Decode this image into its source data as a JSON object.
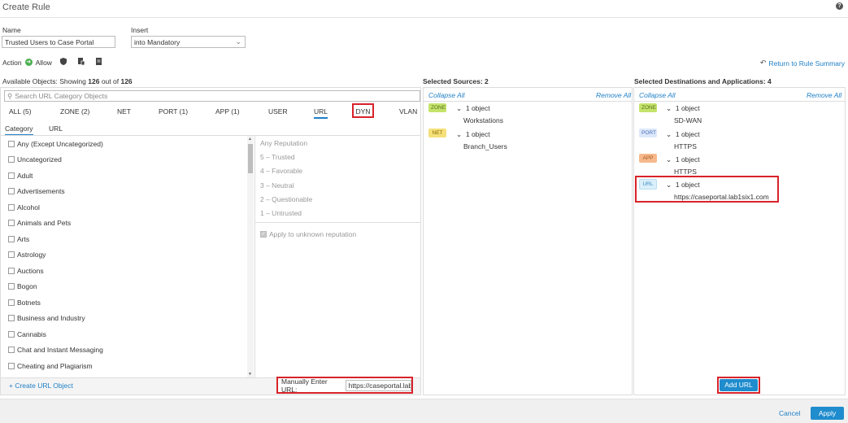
{
  "header": {
    "title": "Create Rule",
    "help_icon": "?"
  },
  "name_field": {
    "label": "Name",
    "value": "Trusted Users to Case Portal"
  },
  "insert_field": {
    "label": "Insert",
    "value": "into Mandatory"
  },
  "action": {
    "label": "Action",
    "value": "Allow"
  },
  "return_link": "Return to Rule Summary",
  "available": {
    "label": "Available Objects:",
    "showing_prefix": "Showing",
    "count": "126",
    "out_of": "out of",
    "total": "126"
  },
  "search": {
    "placeholder": "Search URL Category Objects"
  },
  "tabs": [
    "ALL (5)",
    "ZONE (2)",
    "NET",
    "PORT (1)",
    "APP (1)",
    "USER",
    "URL",
    "DYN",
    "VLAN"
  ],
  "subtabs": [
    "Category",
    "URL"
  ],
  "categories": [
    "Any (Except Uncategorized)",
    "Uncategorized",
    "Adult",
    "Advertisements",
    "Alcohol",
    "Animals and Pets",
    "Arts",
    "Astrology",
    "Auctions",
    "Bogon",
    "Botnets",
    "Business and Industry",
    "Cannabis",
    "Chat and Instant Messaging",
    "Cheating and Plagiarism"
  ],
  "reputation": {
    "items": [
      "Any Reputation",
      "5 – Trusted",
      "4 – Favorable",
      "3 – Neutral",
      "2 – Questionable",
      "1 – Untrusted"
    ],
    "apply_unknown": "Apply to unknown reputation"
  },
  "create_url_object": "+ Create URL Object",
  "manual_url": {
    "label": "Manually Enter URL:",
    "value": "https://caseportal.lab"
  },
  "sources": {
    "title": "Selected Sources: 2",
    "collapse_all": "Collapse All",
    "remove_all": "Remove All",
    "items": [
      {
        "badge": "ZONE",
        "header": "1 object",
        "value": "Workstations"
      },
      {
        "badge": "NET",
        "header": "1 object",
        "value": "Branch_Users"
      }
    ]
  },
  "destinations": {
    "title": "Selected Destinations and Applications: 4",
    "collapse_all": "Collapse All",
    "remove_all": "Remove All",
    "items": [
      {
        "badge": "ZONE",
        "header": "1 object",
        "value": "SD-WAN"
      },
      {
        "badge": "PORT",
        "header": "1 object",
        "value": "HTTPS"
      },
      {
        "badge": "APP",
        "header": "1 object",
        "value": "HTTPS"
      },
      {
        "badge": "URL",
        "header": "1 object",
        "value": "https://caseportal.lab1six1.com"
      }
    ],
    "add_url": "Add URL"
  },
  "footer": {
    "cancel": "Cancel",
    "apply": "Apply"
  },
  "colors": {
    "accent": "#1f8ccd",
    "highlight": "#d8232a"
  }
}
